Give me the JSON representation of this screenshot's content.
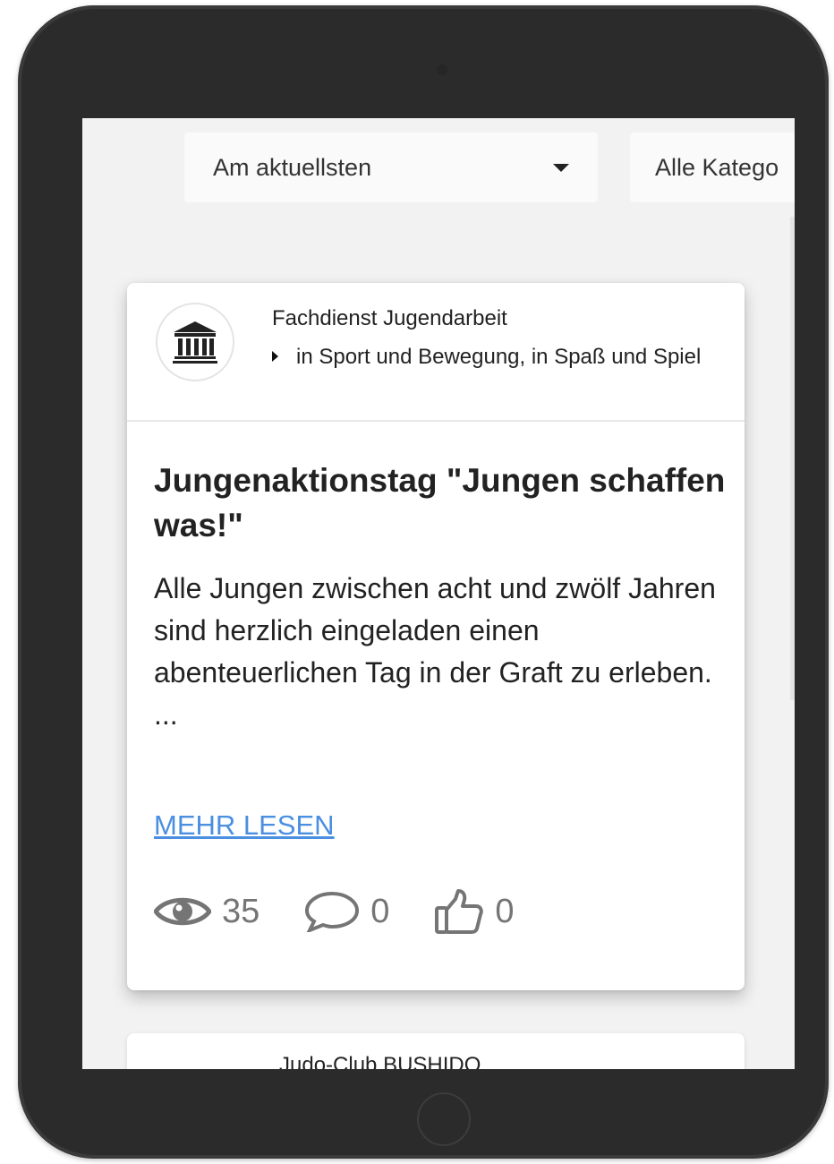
{
  "filters": {
    "sort_label": "Am aktuellsten",
    "category_label": "Alle Katego"
  },
  "post": {
    "org_name": "Fachdienst Jugendarbeit",
    "org_category": "in Sport und Bewegung, in Spaß und Spiel",
    "title": "Jungenaktionstag \"Jungen schaffen was!\"",
    "excerpt": "Alle Jungen zwischen acht und zwölf Jahren sind herzlich eingeladen einen abenteuerlichen Tag in der Graft zu erleben. ...",
    "more_label": "MEHR LESEN",
    "views": "35",
    "comments": "0",
    "likes": "0",
    "link_color": "#4a8fe0"
  },
  "next_post": {
    "org_name": "Judo-Club BUSHIDO"
  },
  "icons": {
    "avatar": "museum-icon",
    "category": "triangle-right-icon",
    "views": "eye-icon",
    "comments": "speech-bubble-icon",
    "likes": "thumbs-up-icon",
    "sort": "caret-down-icon"
  }
}
